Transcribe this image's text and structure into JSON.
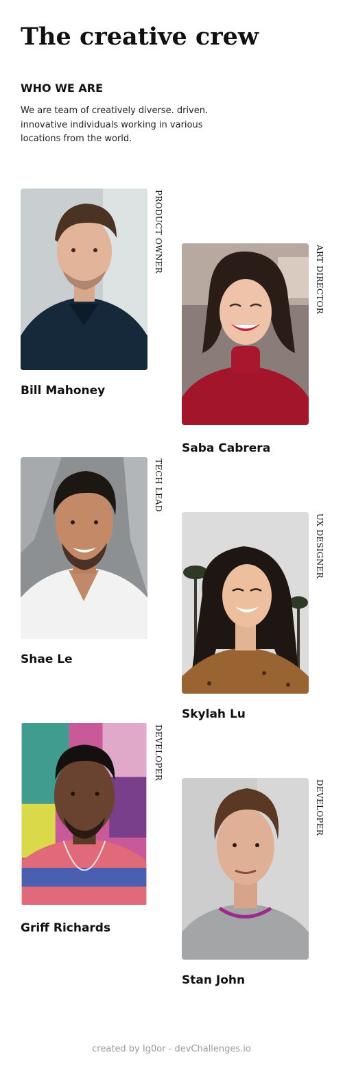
{
  "header": {
    "title": "The creative crew"
  },
  "about": {
    "heading": "WHO WE ARE",
    "text": "We are team of creatively diverse. driven. innovative individuals working in various locations from the world."
  },
  "team": [
    {
      "name": "Bill Mahoney",
      "role": "PRODUCT OWNER",
      "photo": "portrait-bill-mahoney"
    },
    {
      "name": "Saba Cabrera",
      "role": "ART DIRECTOR",
      "photo": "portrait-saba-cabrera"
    },
    {
      "name": "Shae Le",
      "role": "TECH LEAD",
      "photo": "portrait-shae-le"
    },
    {
      "name": "Skylah Lu",
      "role": "UX DESIGNER",
      "photo": "portrait-skylah-lu"
    },
    {
      "name": "Griff Richards",
      "role": "DEVELOPER",
      "photo": "portrait-griff-richards"
    },
    {
      "name": "Stan John",
      "role": "DEVELOPER",
      "photo": "portrait-stan-john"
    }
  ],
  "footer": {
    "credit": "created by Ig0or - devChallenges.io"
  },
  "colors": {
    "text": "#111111",
    "footer_text": "#9a9a9a",
    "background": "#ffffff"
  }
}
